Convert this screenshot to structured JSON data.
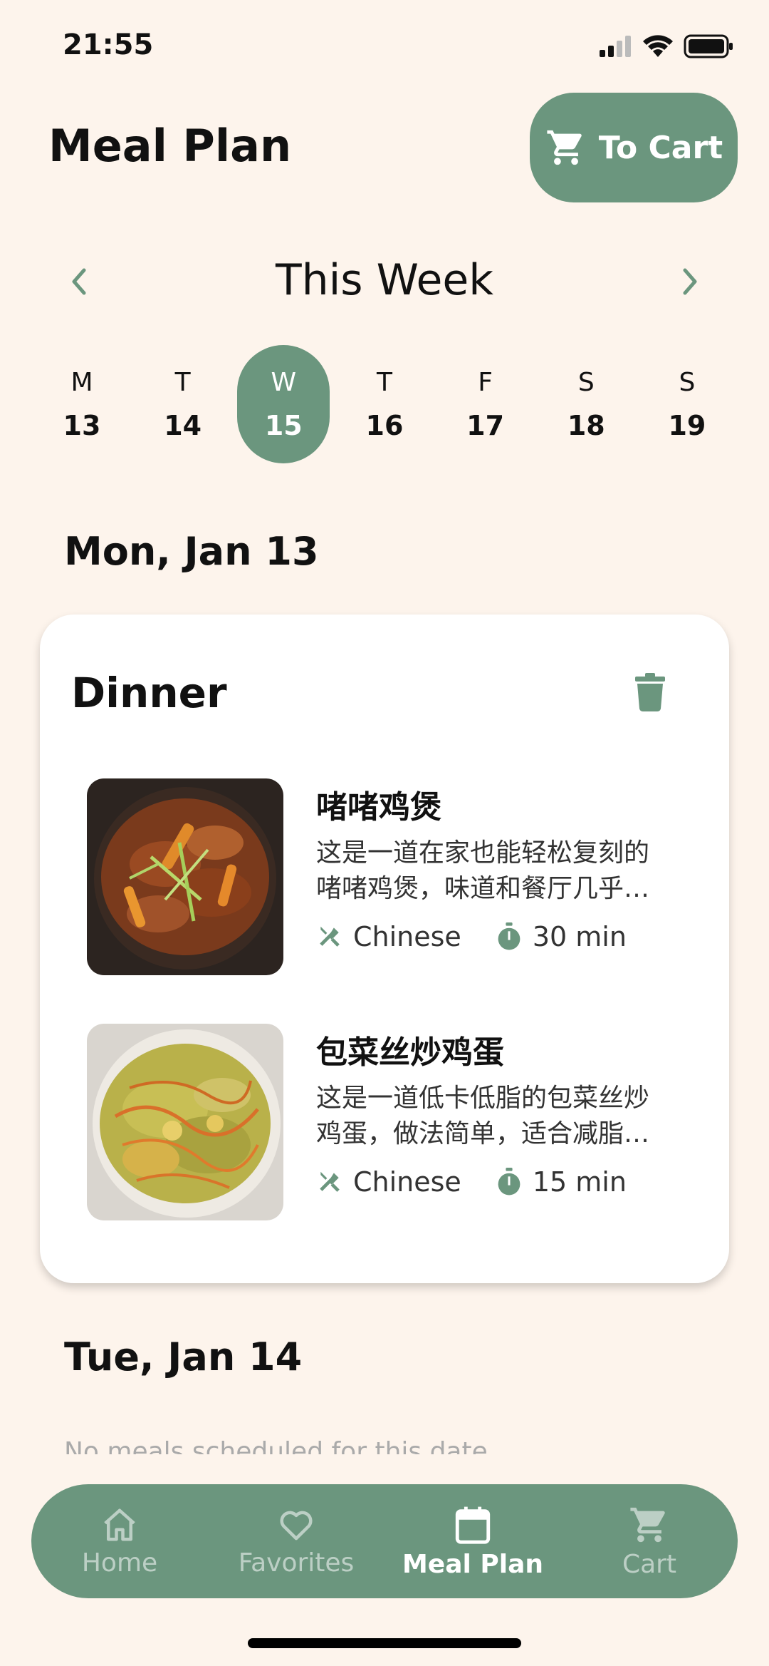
{
  "status": {
    "time": "21:55"
  },
  "header": {
    "title": "Meal Plan",
    "cart_button": "To Cart"
  },
  "week": {
    "label": "This Week",
    "days": [
      {
        "letter": "M",
        "num": "13",
        "selected": false
      },
      {
        "letter": "T",
        "num": "14",
        "selected": false
      },
      {
        "letter": "W",
        "num": "15",
        "selected": true
      },
      {
        "letter": "T",
        "num": "16",
        "selected": false
      },
      {
        "letter": "F",
        "num": "17",
        "selected": false
      },
      {
        "letter": "S",
        "num": "18",
        "selected": false
      },
      {
        "letter": "S",
        "num": "19",
        "selected": false
      }
    ]
  },
  "sections": [
    {
      "date": "Mon, Jan 13",
      "meal_type": "Dinner",
      "recipes": [
        {
          "title": "啫啫鸡煲",
          "desc_line1": "这是一道在家也能轻松复刻的",
          "desc_line2": "啫啫鸡煲，味道和餐厅几乎…",
          "cuisine": "Chinese",
          "time": "30 min"
        },
        {
          "title": "包菜丝炒鸡蛋",
          "desc_line1": "这是一道低卡低脂的包菜丝炒",
          "desc_line2": "鸡蛋，做法简单，适合减脂…",
          "cuisine": "Chinese",
          "time": "15 min"
        }
      ]
    },
    {
      "date": "Tue, Jan 14",
      "empty_text": "No meals scheduled for this date"
    }
  ],
  "bottom_nav": {
    "items": [
      {
        "label": "Home",
        "icon": "home-icon"
      },
      {
        "label": "Favorites",
        "icon": "heart-icon"
      },
      {
        "label": "Meal Plan",
        "icon": "calendar-icon",
        "active": true
      },
      {
        "label": "Cart",
        "icon": "cart-icon"
      }
    ]
  },
  "colors": {
    "accent": "#6b967e",
    "background": "#fdf4ec"
  }
}
